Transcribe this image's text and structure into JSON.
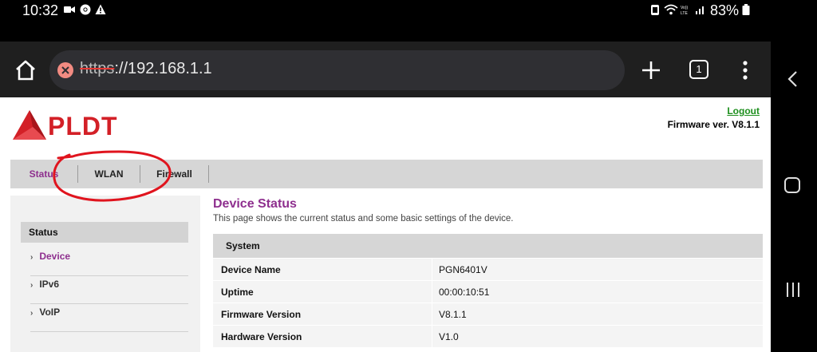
{
  "status_bar": {
    "time": "10:32",
    "battery": "83%"
  },
  "browser": {
    "url_scheme": "https",
    "url_rest": "://192.168.1.1",
    "tab_count": "1"
  },
  "header": {
    "brand": "PLDT",
    "logout": "Logout",
    "firmware": "Firmware ver. V8.1.1"
  },
  "menu": {
    "items": [
      {
        "label": "Status"
      },
      {
        "label": "WLAN"
      },
      {
        "label": "Firewall"
      }
    ]
  },
  "sidebar": {
    "heading": "Status",
    "items": [
      {
        "label": "Device"
      },
      {
        "label": "IPv6"
      },
      {
        "label": "VoIP"
      }
    ]
  },
  "main": {
    "title": "Device Status",
    "description": "This page shows the current status and some basic settings of the device.",
    "panel_title": "System",
    "rows": [
      {
        "key": "Device Name",
        "value": "PGN6401V"
      },
      {
        "key": "Uptime",
        "value": "00:00:10:51"
      },
      {
        "key": "Firmware Version",
        "value": "V8.1.1"
      },
      {
        "key": "Hardware Version",
        "value": "V1.0"
      }
    ]
  },
  "colors": {
    "accent": "#8e2f8e",
    "brand_red": "#d32027",
    "logout_green": "#1e8f1e",
    "annotation_red": "#e0141e"
  },
  "icons": [
    "video-icon",
    "chrome-icon",
    "warning-icon",
    "battery-saver-icon",
    "wifi-icon",
    "volte-icon",
    "signal-icon",
    "battery-icon",
    "home-icon",
    "insecure-icon",
    "plus-icon",
    "more-icon",
    "back-icon",
    "recents-icon"
  ]
}
